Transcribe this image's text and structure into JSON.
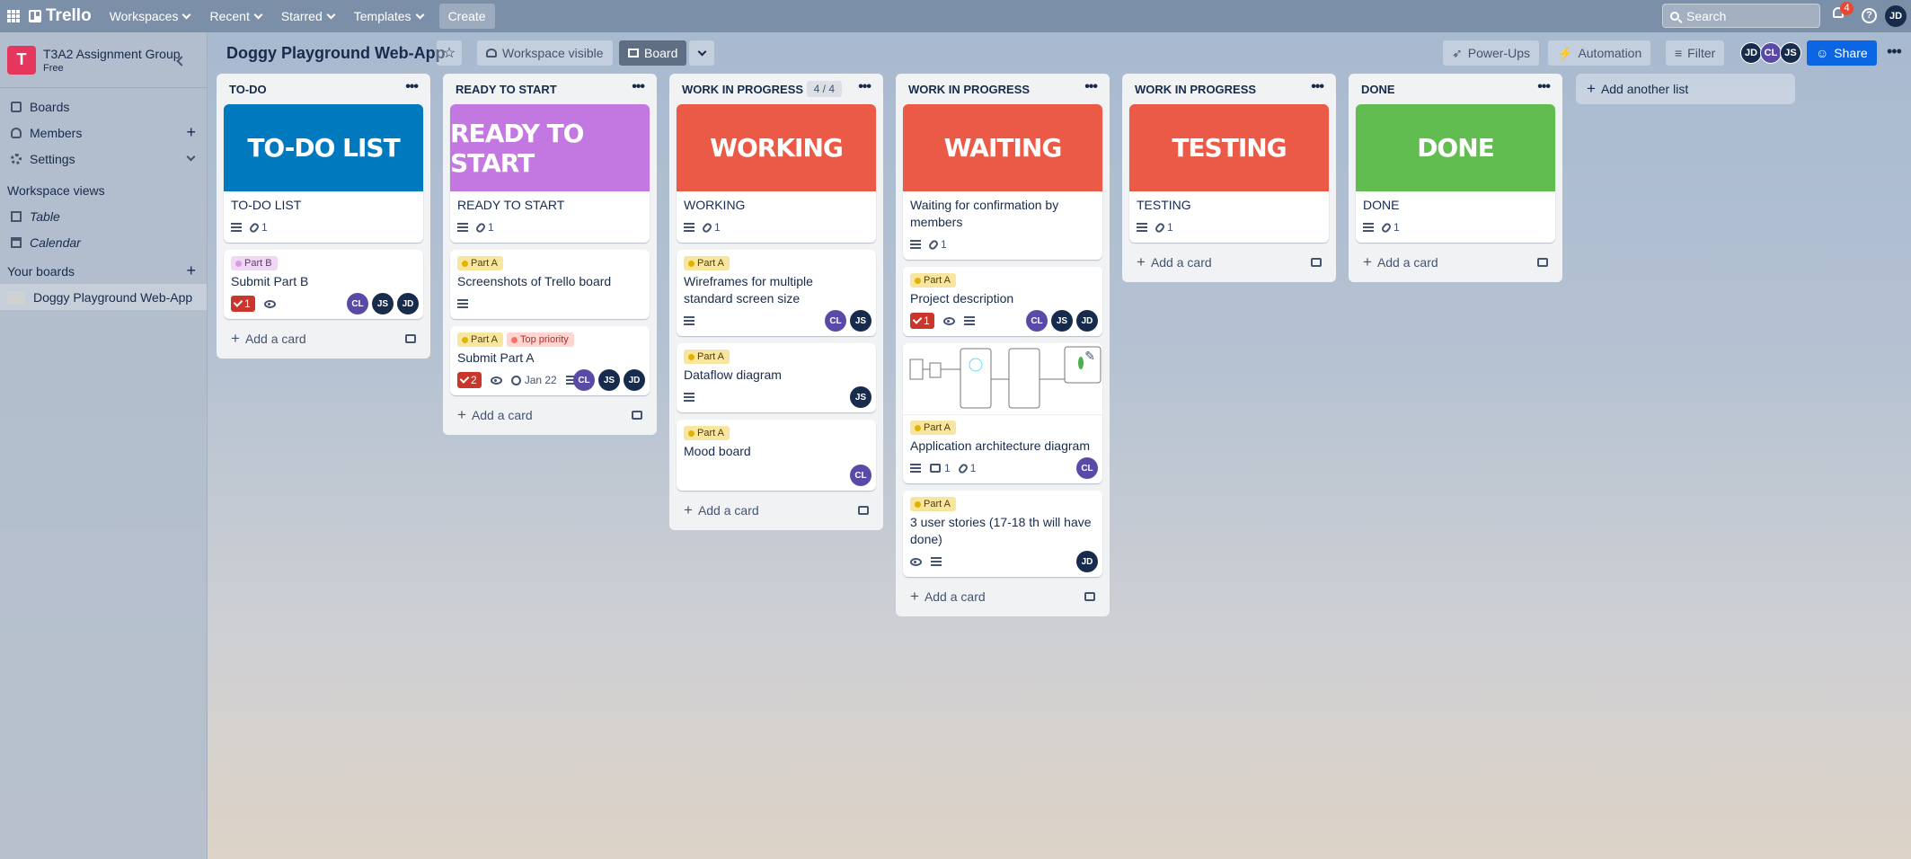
{
  "topbar": {
    "app_name": "Trello",
    "nav": [
      "Workspaces",
      "Recent",
      "Starred",
      "Templates"
    ],
    "create_label": "Create",
    "search_placeholder": "Search",
    "notifications_count": "4",
    "user_initials": "JD"
  },
  "sidebar": {
    "workspace_initial": "T",
    "workspace_name": "T3A2 Assignment Group",
    "workspace_plan": "Free",
    "items": [
      "Boards",
      "Members",
      "Settings"
    ],
    "views_heading": "Workspace views",
    "views": [
      "Table",
      "Calendar"
    ],
    "boards_heading": "Your boards",
    "boards": [
      "Doggy Playground Web-App"
    ]
  },
  "board": {
    "title": "Doggy Playground Web-App",
    "visibility": "Workspace visible",
    "view_label": "Board",
    "powerups": "Power-Ups",
    "automation": "Automation",
    "filter": "Filter",
    "members": [
      "JD",
      "CL",
      "JS"
    ],
    "share": "Share"
  },
  "lists": [
    {
      "name": "TO-DO",
      "cover_text": "TO-DO LIST",
      "cover_color": "#0079bf",
      "cover_card_title": "TO-DO LIST",
      "cover_card_attachments": "1",
      "cards": [
        {
          "labels": [
            {
              "text": "Part B",
              "kind": "b"
            }
          ],
          "title": "Submit Part B",
          "checklist": "1",
          "watch": true,
          "members": [
            "CL",
            "JS",
            "JD"
          ]
        }
      ],
      "add": "Add a card"
    },
    {
      "name": "READY TO START",
      "cover_text": "READY TO START",
      "cover_color": "#c377e0",
      "cover_card_title": "READY TO START",
      "cover_card_attachments": "1",
      "cards": [
        {
          "labels": [
            {
              "text": "Part A",
              "kind": "a"
            }
          ],
          "title": "Screenshots of Trello board",
          "desc": true
        },
        {
          "labels": [
            {
              "text": "Part A",
              "kind": "a"
            },
            {
              "text": "Top priority",
              "kind": "tp"
            }
          ],
          "title": "Submit Part A",
          "checklist": "2",
          "watch": true,
          "due": "Jan 22",
          "desc": true,
          "members": [
            "CL",
            "JS",
            "JD"
          ]
        }
      ],
      "add": "Add a card"
    },
    {
      "name": "WORK IN PROGRESS",
      "count": "4 / 4",
      "cover_text": "WORKING",
      "cover_color": "#eb5a46",
      "cover_card_title": "WORKING",
      "cover_card_attachments": "1",
      "cards": [
        {
          "labels": [
            {
              "text": "Part A",
              "kind": "a"
            }
          ],
          "title": "Wireframes for multiple standard screen size",
          "desc": true,
          "members": [
            "CL",
            "JS"
          ]
        },
        {
          "labels": [
            {
              "text": "Part A",
              "kind": "a"
            }
          ],
          "title": "Dataflow diagram",
          "desc": true,
          "members": [
            "JS"
          ]
        },
        {
          "labels": [
            {
              "text": "Part A",
              "kind": "a"
            }
          ],
          "title": "Mood board",
          "members": [
            "CL"
          ]
        }
      ],
      "add": "Add a card"
    },
    {
      "name": "WORK IN PROGRESS",
      "cover_text": "WAITING",
      "cover_color": "#eb5a46",
      "cover_card_title": "Waiting for confirmation by members",
      "cover_card_attachments": "1",
      "cards": [
        {
          "labels": [
            {
              "text": "Part A",
              "kind": "a"
            }
          ],
          "title": "Project description",
          "checklist": "1",
          "watch": true,
          "desc": true,
          "members": [
            "CL",
            "JS",
            "JD"
          ]
        },
        {
          "image": true,
          "labels": [
            {
              "text": "Part A",
              "kind": "a"
            }
          ],
          "title": "Application architecture diagram",
          "desc": true,
          "comments": "1",
          "attachments": "1",
          "members": [
            "CL"
          ]
        },
        {
          "labels": [
            {
              "text": "Part A",
              "kind": "a"
            }
          ],
          "title": "3 user stories (17-18 th will have done)",
          "watch": true,
          "desc": true,
          "members": [
            "JD"
          ]
        }
      ],
      "add": "Add a card"
    },
    {
      "name": "WORK IN PROGRESS",
      "cover_text": "TESTING",
      "cover_color": "#eb5a46",
      "cover_card_title": "TESTING",
      "cover_card_attachments": "1",
      "cards": [],
      "add": "Add a card"
    },
    {
      "name": "DONE",
      "cover_text": "DONE",
      "cover_color": "#61bd4f",
      "cover_card_title": "DONE",
      "cover_card_attachments": "1",
      "cards": [],
      "add": "Add a card"
    }
  ],
  "add_list": "Add another list"
}
